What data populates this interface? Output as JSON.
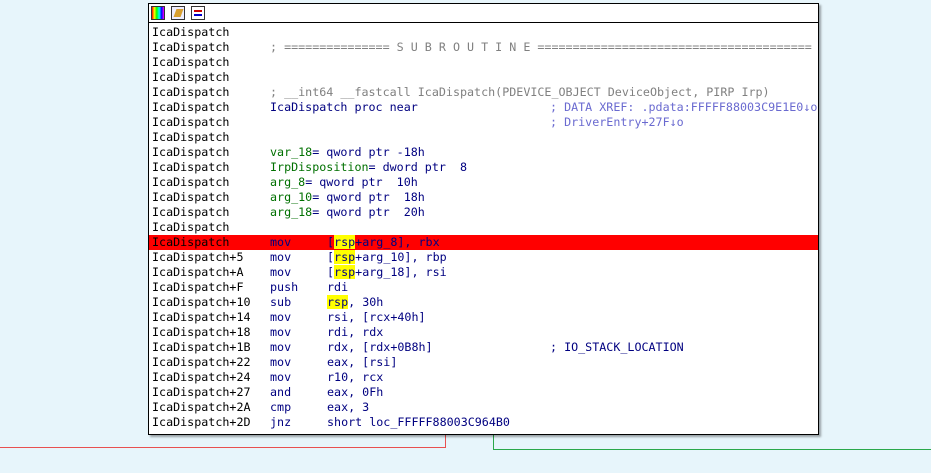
{
  "node": {
    "header_icons": [
      "color-palette-icon",
      "edit-node-icon",
      "graph-view-icon"
    ],
    "lines": [
      {
        "addr": "IcaDispatch",
        "type": "blank"
      },
      {
        "addr": "IcaDispatch",
        "type": "comment",
        "text": "; =============== S U B R O U T I N E ======================================="
      },
      {
        "addr": "IcaDispatch",
        "type": "blank"
      },
      {
        "addr": "IcaDispatch",
        "type": "blank"
      },
      {
        "addr": "IcaDispatch",
        "type": "comment",
        "text": "; __int64 __fastcall IcaDispatch(PDEVICE_OBJECT DeviceObject, PIRP Irp)"
      },
      {
        "addr": "IcaDispatch",
        "type": "proc",
        "text": "IcaDispatch proc near",
        "comment": "; DATA XREF: .pdata:FFFFF88003C9E1E0↓o"
      },
      {
        "addr": "IcaDispatch",
        "type": "xref",
        "comment": "; DriverEntry+27F↓o"
      },
      {
        "addr": "IcaDispatch",
        "type": "blank"
      },
      {
        "addr": "IcaDispatch",
        "type": "var",
        "name": "var_18",
        "rest": "= qword ptr -18h"
      },
      {
        "addr": "IcaDispatch",
        "type": "var",
        "name": "IrpDisposition",
        "rest": "= dword ptr  8"
      },
      {
        "addr": "IcaDispatch",
        "type": "var",
        "name": "arg_8",
        "rest": "= qword ptr  10h"
      },
      {
        "addr": "IcaDispatch",
        "type": "var",
        "name": "arg_10",
        "rest": "= qword ptr  18h"
      },
      {
        "addr": "IcaDispatch",
        "type": "var",
        "name": "arg_18",
        "rest": "= qword ptr  20h"
      },
      {
        "addr": "IcaDispatch",
        "type": "blank"
      },
      {
        "addr": "IcaDispatch",
        "type": "insn",
        "op": "mov",
        "pre": "[",
        "reg": "rsp",
        "post": "+arg_8], rbx",
        "highlight": true
      },
      {
        "addr": "IcaDispatch+5",
        "type": "insn",
        "op": "mov",
        "pre": "[",
        "reg": "rsp",
        "post": "+arg_10], rbp"
      },
      {
        "addr": "IcaDispatch+A",
        "type": "insn",
        "op": "mov",
        "pre": "[",
        "reg": "rsp",
        "post": "+arg_18], rsi"
      },
      {
        "addr": "IcaDispatch+F",
        "type": "insn",
        "op": "push",
        "pre": "rdi",
        "reg": "",
        "post": ""
      },
      {
        "addr": "IcaDispatch+10",
        "type": "insn",
        "op": "sub",
        "pre": "",
        "reg": "rsp",
        "post": ", 30h"
      },
      {
        "addr": "IcaDispatch+14",
        "type": "insn",
        "op": "mov",
        "pre": "rsi, [rcx+40h]",
        "reg": "",
        "post": ""
      },
      {
        "addr": "IcaDispatch+18",
        "type": "insn",
        "op": "mov",
        "pre": "rdi, rdx",
        "reg": "",
        "post": ""
      },
      {
        "addr": "IcaDispatch+1B",
        "type": "insn",
        "op": "mov",
        "pre": "rdx, [rdx+0B8h]",
        "reg": "",
        "post": "",
        "comment": "; IO_STACK_LOCATION"
      },
      {
        "addr": "IcaDispatch+22",
        "type": "insn",
        "op": "mov",
        "pre": "eax, [rsi]",
        "reg": "",
        "post": ""
      },
      {
        "addr": "IcaDispatch+24",
        "type": "insn",
        "op": "mov",
        "pre": "r10, rcx",
        "reg": "",
        "post": ""
      },
      {
        "addr": "IcaDispatch+27",
        "type": "insn",
        "op": "and",
        "pre": "eax, 0Fh",
        "reg": "",
        "post": ""
      },
      {
        "addr": "IcaDispatch+2A",
        "type": "insn",
        "op": "cmp",
        "pre": "eax, 3",
        "reg": "",
        "post": ""
      },
      {
        "addr": "IcaDispatch+2D",
        "type": "insn",
        "op": "jnz",
        "pre": "short loc_FFFFF88003C964B0",
        "reg": "",
        "post": ""
      }
    ]
  },
  "colors": {
    "highlight_line": "#ff0000",
    "register_highlight": "#ffff00",
    "false_edge": "#e85050",
    "true_edge": "#2aa84a"
  }
}
